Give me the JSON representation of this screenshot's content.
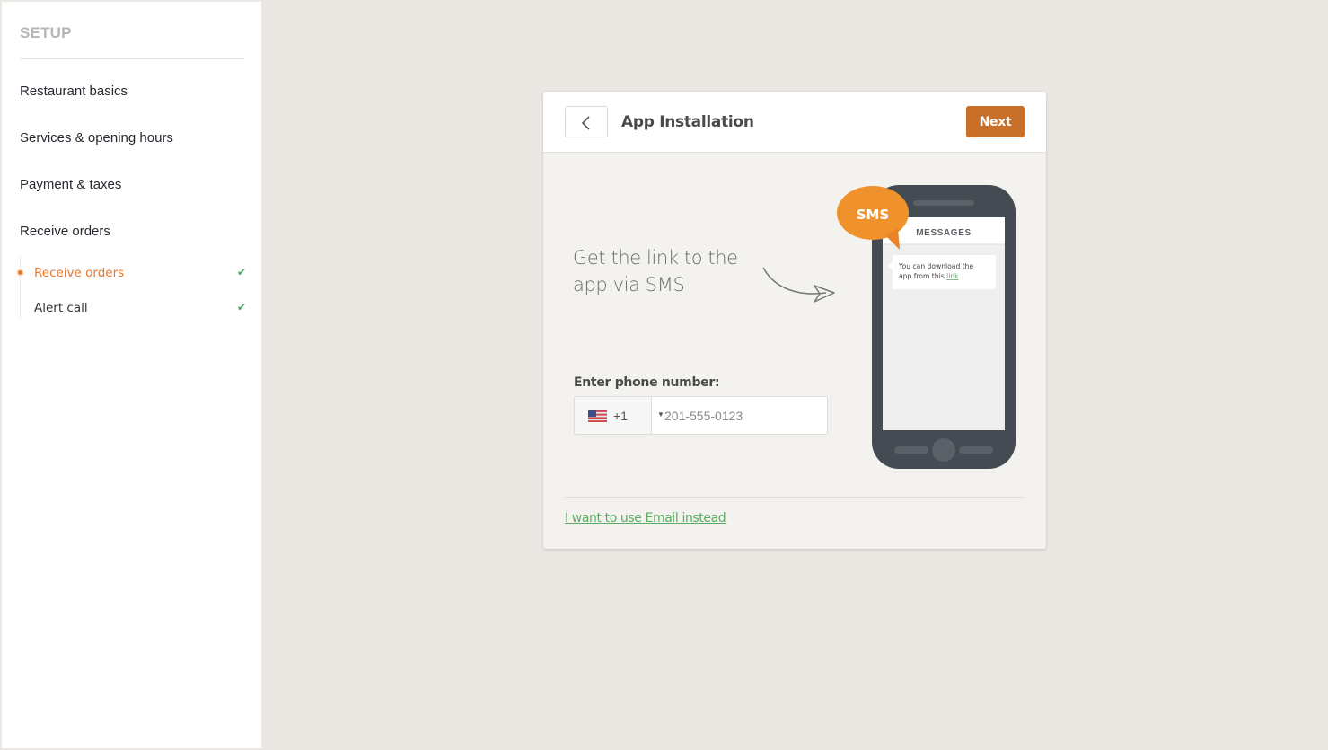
{
  "sidebar": {
    "title": "SETUP",
    "items": [
      {
        "label": "Restaurant basics"
      },
      {
        "label": "Services & opening hours"
      },
      {
        "label": "Payment & taxes"
      },
      {
        "label": "Receive orders"
      }
    ],
    "sub_items": [
      {
        "label": "Receive orders",
        "active": true,
        "completed": true,
        "check": "✔"
      },
      {
        "label": "Alert call",
        "active": false,
        "completed": true,
        "check": "✔"
      }
    ]
  },
  "card": {
    "title": "App Installation",
    "next_label": "Next",
    "promo_line1": "Get the link to the",
    "promo_line2": "app via SMS",
    "phone_illustration": {
      "bubble_label": "SMS",
      "screen_header": "MESSAGES",
      "message_text": "You can download the",
      "message_text2": "app from this",
      "message_link": "link"
    },
    "phone_label": "Enter phone number:",
    "country": {
      "flag": "us-flag-icon",
      "dial_code": "+1"
    },
    "phone_placeholder": "201-555-0123",
    "phone_value": "",
    "email_link": "I want to use Email instead"
  },
  "colors": {
    "accent_orange": "#e8772e",
    "next_button": "#c8702a",
    "check_green": "#48a55a",
    "link_green": "#5aad62",
    "phone_body": "#454b52"
  }
}
